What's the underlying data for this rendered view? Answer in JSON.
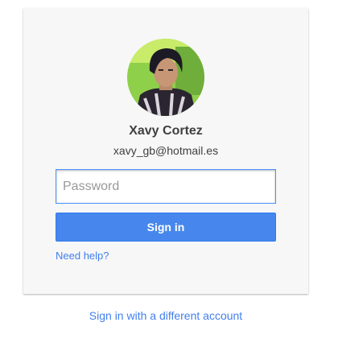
{
  "account": {
    "name": "Xavy Cortez",
    "email": "xavy_gb@hotmail.es"
  },
  "form": {
    "password_placeholder": "Password",
    "signin_label": "Sign in",
    "help_label": "Need help?"
  },
  "footer": {
    "different_account_label": "Sign in with a different account"
  },
  "colors": {
    "card_background": "#f7f7f7",
    "accent": "#4787ed",
    "link": "#427fed"
  }
}
